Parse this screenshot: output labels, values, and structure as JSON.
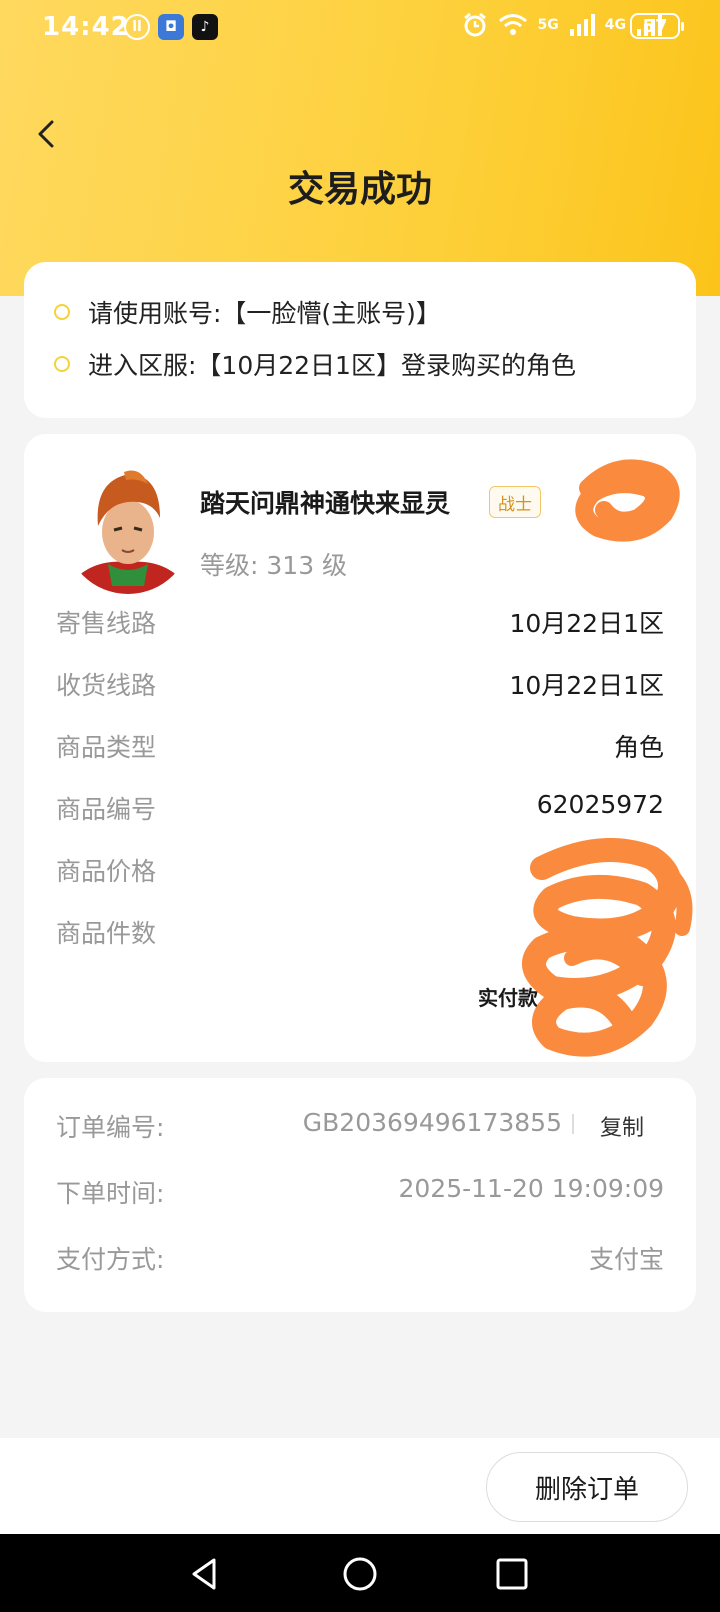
{
  "status_bar": {
    "time": "14:42",
    "battery": "57",
    "network_1": "5G",
    "network_2": "4G",
    "icons": [
      "notification-icon",
      "app-icon",
      "tiktok-icon",
      "alarm-icon",
      "wifi-icon",
      "signal-icon"
    ]
  },
  "header": {
    "title": "交易成功"
  },
  "notice": {
    "items": [
      {
        "text": "请使用账号:【一脸懵(主账号)】"
      },
      {
        "text": "进入区服:【10月22日1区】登录购买的角色"
      }
    ]
  },
  "character": {
    "name": "踏天问鼎神通快来显灵",
    "class": "战士",
    "level_label": "等级:",
    "level": "313 级"
  },
  "item_details": [
    {
      "label": "寄售线路",
      "value": "10月22日1区"
    },
    {
      "label": "收货线路",
      "value": "10月22日1区"
    },
    {
      "label": "商品类型",
      "value": "角色"
    },
    {
      "label": "商品编号",
      "value": "62025972"
    },
    {
      "label": "商品价格",
      "value": ""
    },
    {
      "label": "商品件数",
      "value": ""
    }
  ],
  "paid_label": "实付款",
  "order": {
    "number_label": "订单编号:",
    "number": "GB20369496173855",
    "copy_label": "复制",
    "time_label": "下单时间:",
    "time": "2025-11-20 19:09:09",
    "payment_label": "支付方式:",
    "payment": "支付宝"
  },
  "actions": {
    "delete_label": "删除订单"
  },
  "colors": {
    "header_yellow": "#fdd03a",
    "accent_yellow": "#f5d23a",
    "badge_orange": "#d5921c",
    "redaction_orange": "#fa8a3e"
  }
}
